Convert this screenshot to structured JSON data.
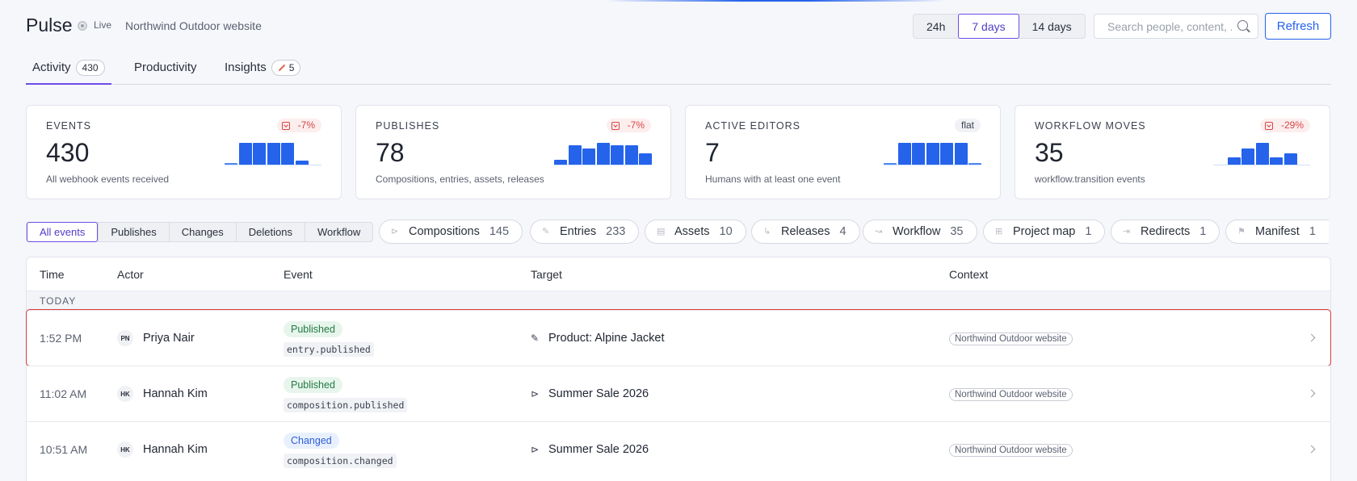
{
  "header": {
    "title": "Pulse",
    "live_label": "Live",
    "site_name": "Northwind Outdoor website",
    "ranges": [
      "24h",
      "7 days",
      "14 days"
    ],
    "active_range": "7 days",
    "search_placeholder": "Search people, content, ...",
    "refresh_label": "Refresh"
  },
  "tabs": [
    {
      "label": "Activity",
      "count": "430"
    },
    {
      "label": "Productivity"
    },
    {
      "label": "Insights",
      "count": "5"
    }
  ],
  "metrics": [
    {
      "label": "EVENTS",
      "value": "430",
      "sub": "All webhook events received",
      "delta": "-7%",
      "spark": [
        0.05,
        0.9,
        0.9,
        0.9,
        0.9,
        0.15
      ]
    },
    {
      "label": "PUBLISHES",
      "value": "78",
      "sub": "Compositions, entries, assets, releases",
      "delta": "-7%",
      "spark": [
        0.2,
        0.8,
        0.65,
        0.9,
        0.8,
        0.8,
        0.45
      ]
    },
    {
      "label": "ACTIVE EDITORS",
      "value": "7",
      "sub": "Humans with at least one event",
      "delta": "flat",
      "spark": [
        0.05,
        0.9,
        0.9,
        0.9,
        0.9,
        0.9,
        0.05
      ]
    },
    {
      "label": "WORKFLOW MOVES",
      "value": "35",
      "sub": "workflow.transition events",
      "delta": "-29%",
      "spark": [
        0.0,
        0.3,
        0.65,
        0.9,
        0.3,
        0.45,
        0.0
      ]
    }
  ],
  "filters": {
    "segments": [
      "All events",
      "Publishes",
      "Changes",
      "Deletions",
      "Workflow"
    ],
    "active_segment": "All events",
    "chips": [
      {
        "label": "Compositions",
        "count": "145",
        "icon": "composition-icon"
      },
      {
        "label": "Entries",
        "count": "233",
        "icon": "pencil-icon"
      },
      {
        "label": "Assets",
        "count": "10",
        "icon": "file-icon"
      },
      {
        "label": "Releases",
        "count": "4",
        "icon": "release-icon"
      },
      {
        "label": "Workflow",
        "count": "35",
        "icon": "workflow-icon"
      },
      {
        "label": "Project map",
        "count": "1",
        "icon": "sitemap-icon"
      },
      {
        "label": "Redirects",
        "count": "1",
        "icon": "redirect-icon"
      },
      {
        "label": "Manifest",
        "count": "1",
        "icon": "flag-icon"
      }
    ]
  },
  "table": {
    "columns": [
      "Time",
      "Actor",
      "Event",
      "Target",
      "Context"
    ],
    "group_label": "TODAY",
    "rows": [
      {
        "time": "1:52 PM",
        "initials": "PN",
        "actor": "Priya Nair",
        "badge": "Published",
        "event_code": "entry.published",
        "target": "Product: Alpine Jacket",
        "target_icon": "pencil-icon",
        "context": "Northwind Outdoor website",
        "selected": true
      },
      {
        "time": "11:02 AM",
        "initials": "HK",
        "actor": "Hannah Kim",
        "badge": "Published",
        "event_code": "composition.published",
        "target": "Summer Sale 2026",
        "target_icon": "composition-icon",
        "context": "Northwind Outdoor website"
      },
      {
        "time": "10:51 AM",
        "initials": "HK",
        "actor": "Hannah Kim",
        "badge": "Changed",
        "event_code": "composition.changed",
        "target": "Summer Sale 2026",
        "target_icon": "composition-icon",
        "context": "Northwind Outdoor website"
      }
    ]
  }
}
